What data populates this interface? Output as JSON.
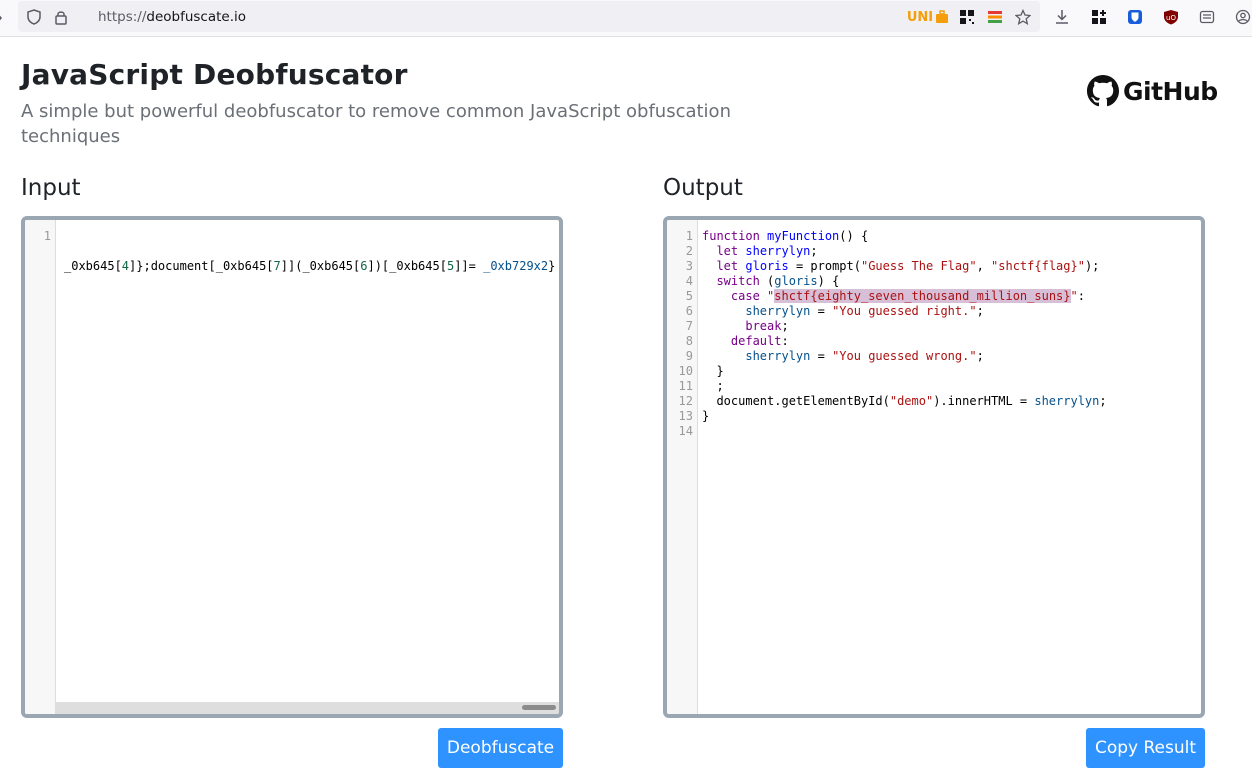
{
  "browser": {
    "url_scheme": "https://",
    "url_host": "deobfuscate.io",
    "ext_label": "UNI"
  },
  "header": {
    "title": "JavaScript Deobfuscator",
    "subtitle": "A simple but powerful deobfuscator to remove common JavaScript obfuscation techniques",
    "github_label": "GitHub"
  },
  "input": {
    "heading": "Input",
    "line_numbers": [
      "1"
    ],
    "code_line": "_0xb645[4]};document[_0xb645[7]](_0xb645[6])[_0xb645[5]]= _0xb729x2}"
  },
  "output": {
    "heading": "Output",
    "line_numbers": [
      "1",
      "2",
      "3",
      "4",
      "5",
      "6",
      "7",
      "8",
      "9",
      "10",
      "11",
      "12",
      "13",
      "14"
    ],
    "lines": [
      "function myFunction() {",
      "  let sherrylyn;",
      "  let gloris = prompt(\"Guess The Flag\", \"shctf{flag}\");",
      "  switch (gloris) {",
      "    case \"shctf{eighty_seven_thousand_million_suns}\":",
      "      sherrylyn = \"You guessed right.\";",
      "      break;",
      "    default:",
      "      sherrylyn = \"You guessed wrong.\";",
      "  }",
      "  ;",
      "  document.getElementById(\"demo\").innerHTML = sherrylyn;",
      "}",
      ""
    ]
  },
  "buttons": {
    "deobfuscate": "Deobfuscate",
    "copy": "Copy Result"
  },
  "colors": {
    "accent": "#2f93ff",
    "editor_border": "#9aa6b2"
  }
}
